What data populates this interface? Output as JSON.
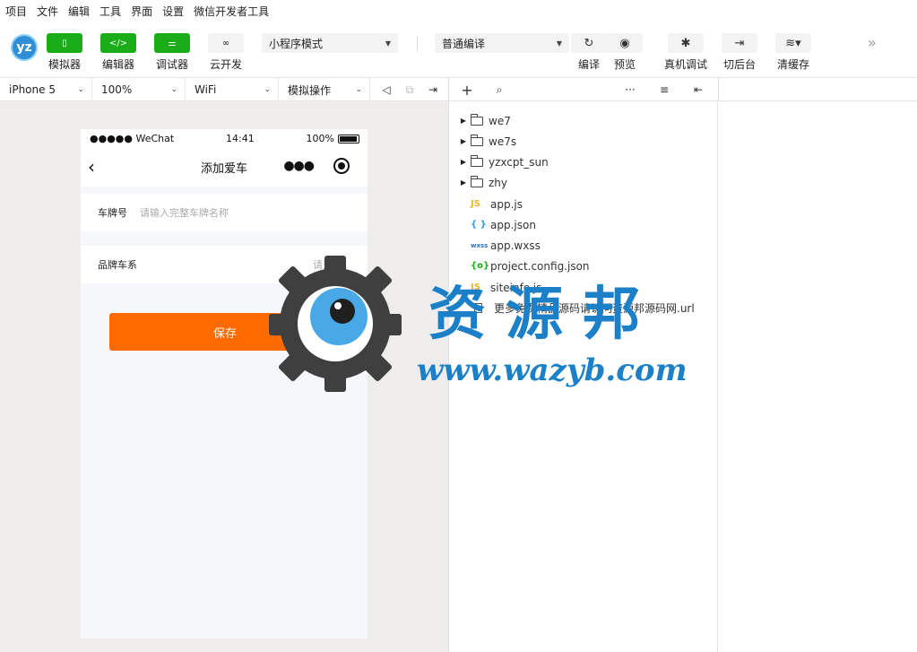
{
  "menu": [
    "项目",
    "文件",
    "编辑",
    "工具",
    "界面",
    "设置",
    "微信开发者工具"
  ],
  "logo_text": "yz",
  "toolbar": {
    "simulator": "模拟器",
    "editor": "编辑器",
    "debugger": "调试器",
    "cloud": "云开发",
    "mode_select": "小程序模式",
    "compile_select": "普通编译",
    "compile": "编译",
    "preview": "预览",
    "real_debug": "真机调试",
    "background": "切后台",
    "clear_cache": "清缓存"
  },
  "subbar": {
    "device": "iPhone 5",
    "zoom": "100%",
    "network": "WiFi",
    "operation": "模拟操作"
  },
  "phone": {
    "status_carrier": "●●●●● WeChat",
    "status_time": "14:41",
    "status_battery": "100%",
    "nav_title": "添加爱车",
    "plate_label": "车牌号",
    "plate_placeholder": "请输入完整车牌名称",
    "brand_label": "品牌车系",
    "brand_placeholder": "请选择",
    "save_label": "保存"
  },
  "files": {
    "folders": [
      "we7",
      "we7s",
      "yzxcpt_sun",
      "zhy"
    ],
    "app_js": "app.js",
    "app_json": "app.json",
    "app_wxss": "app.wxss",
    "project_config": "project.config.json",
    "siteinfo": "siteinfo.js",
    "url_file": "更多免费精品源码请访问资源邦源码网.url"
  },
  "file_icons": {
    "js": "JS",
    "json": "{ }",
    "wxss": "wxss",
    "config": "{o}"
  },
  "watermark": {
    "title": "资源邦",
    "url": "www.wazyb.com"
  },
  "colors": {
    "accent_green": "#1aad19",
    "save_orange": "#ff6a00",
    "watermark_blue": "#1c80c9"
  }
}
